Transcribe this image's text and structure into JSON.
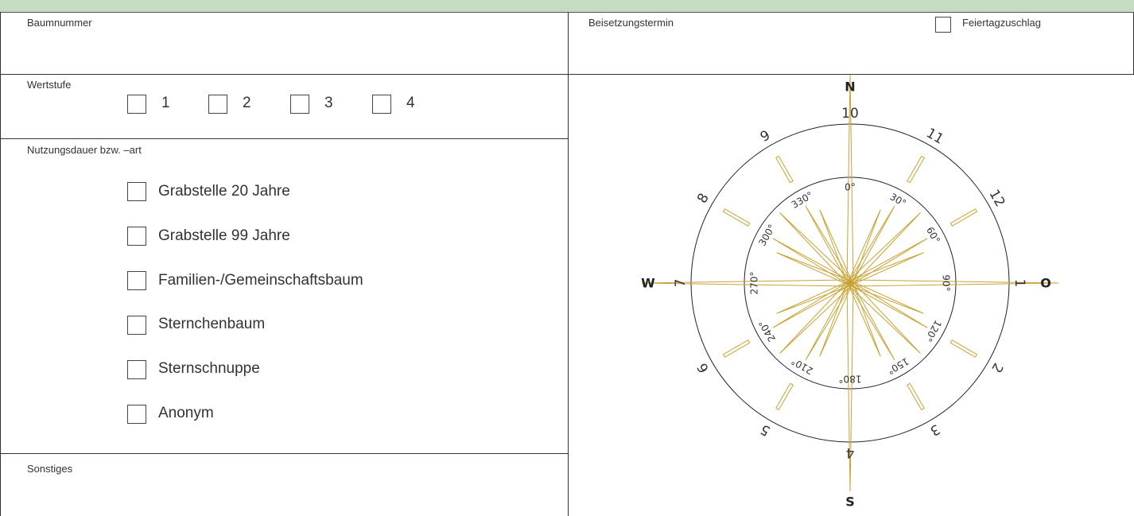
{
  "form": {
    "baumnummer_label": "Baumnummer",
    "beisetzung_label": "Beisetzungstermin",
    "feiertag_label": "Feiertagzuschlag",
    "wertstufe_label": "Wertstufe",
    "wertstufe_options": [
      "1",
      "2",
      "3",
      "4"
    ],
    "nutzung_label": "Nutzungsdauer bzw. –art",
    "nutzung_options": [
      "Grabstelle 20 Jahre",
      "Grabstelle 99 Jahre",
      "Familien-/Gemeinschaftsbaum",
      "Sternchenbaum",
      "Sternschnuppe",
      "Anonym"
    ],
    "sonstiges_label": "Sonstiges"
  },
  "compass": {
    "cardinals": {
      "n": "N",
      "s": "S",
      "w": "W",
      "o": "O"
    },
    "outer_numbers": [
      "10",
      "11",
      "12",
      "1",
      "2",
      "3",
      "4",
      "5",
      "6",
      "7",
      "8",
      "9"
    ],
    "degree_labels": [
      "0°",
      "30°",
      "60°",
      "90°",
      "120°",
      "150°",
      "180°",
      "210°",
      "240°",
      "270°",
      "300°",
      "330°"
    ],
    "gold": "#c9a335",
    "line": "#222222"
  },
  "colors": {
    "header_green": "#c5dcc0"
  }
}
